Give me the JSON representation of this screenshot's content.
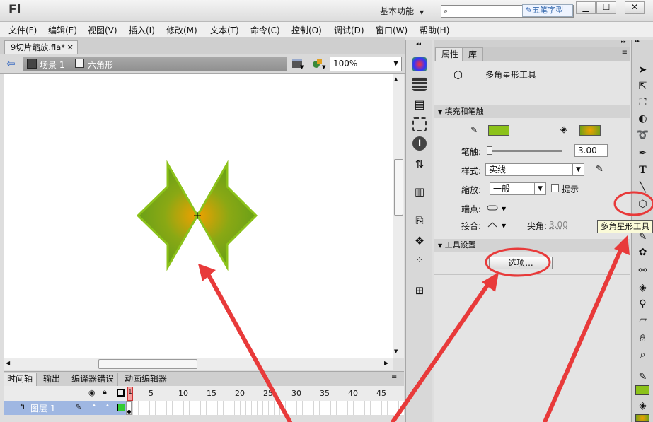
{
  "app": {
    "logo": "Fl",
    "workspace": "基本功能",
    "watermark": "五笔字型",
    "win_min": "▁",
    "win_max": "☐",
    "win_close": "✕"
  },
  "menu": [
    "文件(F)",
    "编辑(E)",
    "视图(V)",
    "插入(I)",
    "修改(M)",
    "文本(T)",
    "命令(C)",
    "控制(O)",
    "调试(D)",
    "窗口(W)",
    "帮助(H)"
  ],
  "document": {
    "tab_title": "9切片缩放.fla*",
    "breadcrumb_scene": "场景 1",
    "breadcrumb_symbol": "六角形",
    "zoom": "100%"
  },
  "timeline": {
    "tabs": [
      "时间轴",
      "输出",
      "编译器错误",
      "动画编辑器"
    ],
    "frame_numbers": [
      "1",
      "5",
      "10",
      "15",
      "20",
      "25",
      "30",
      "35",
      "40",
      "45"
    ],
    "layer_name": "图层 1"
  },
  "properties": {
    "tabs": [
      "属性",
      "库"
    ],
    "tool_name": "多角星形工具",
    "section_fill_stroke": "填充和笔触",
    "stroke_label": "笔触:",
    "stroke_value": "3.00",
    "style_label": "样式:",
    "style_value": "实线",
    "scale_label": "缩放:",
    "scale_value": "一般",
    "hint_label": "提示",
    "cap_label": "端点:",
    "join_label": "接合:",
    "miter_label": "尖角:",
    "miter_value": "3.00",
    "section_tool_settings": "工具设置",
    "options_button": "选项..."
  },
  "tooltip": "多角星形工具",
  "colors": {
    "stroke": "#8cc21a",
    "fill_outer": "#6aa018",
    "fill_inner": "#f0a000",
    "annotation_red": "#e83a3a"
  }
}
